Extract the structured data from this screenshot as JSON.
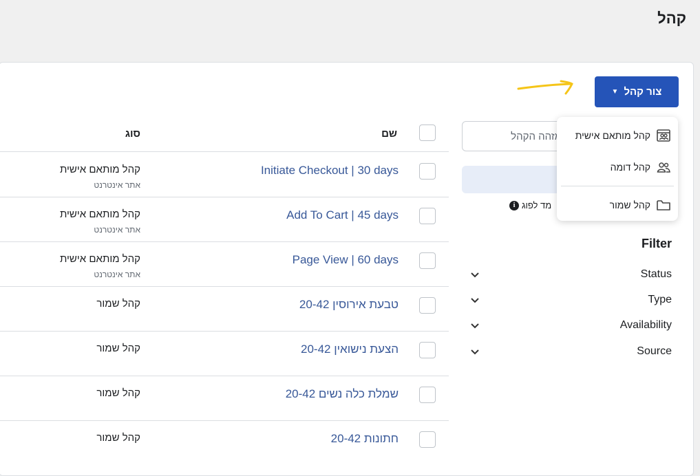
{
  "header": {
    "title": "קהל"
  },
  "create_button": {
    "label": "צור קהל"
  },
  "search": {
    "placeholder": "מזהה הקהל"
  },
  "notice": {
    "text": "מד לפוג"
  },
  "dropdown": {
    "items": [
      {
        "label": "קהל מותאם אישית",
        "icon": "custom-audience-icon"
      },
      {
        "label": "קהל דומה",
        "icon": "people-icon"
      },
      {
        "label": "קהל שמור",
        "icon": "folder-icon"
      }
    ]
  },
  "filter": {
    "title": "Filter",
    "items": [
      {
        "label": "Status"
      },
      {
        "label": "Type"
      },
      {
        "label": "Availability"
      },
      {
        "label": "Source"
      }
    ]
  },
  "table": {
    "columns": {
      "name": "שם",
      "type": "סוג"
    },
    "rows": [
      {
        "name": "Initiate Checkout | 30 days",
        "type": "קהל מותאם אישית",
        "sub": "אתר אינטרנט"
      },
      {
        "name": "Add To Cart | 45 days",
        "type": "קהל מותאם אישית",
        "sub": "אתר אינטרנט"
      },
      {
        "name": "Page View | 60 days",
        "type": "קהל מותאם אישית",
        "sub": "אתר אינטרנט"
      },
      {
        "name": "טבעת אירוסין 20-42",
        "type": "קהל שמור",
        "sub": ""
      },
      {
        "name": "הצעת נישואין 20-42",
        "type": "קהל שמור",
        "sub": ""
      },
      {
        "name": "שמלת כלה נשים 20-42",
        "type": "קהל שמור",
        "sub": ""
      },
      {
        "name": "חתונות 20-42",
        "type": "קהל שמור",
        "sub": ""
      }
    ]
  },
  "colors": {
    "primary": "#2554b8",
    "link": "#385898",
    "annotation": "#f5c518"
  }
}
